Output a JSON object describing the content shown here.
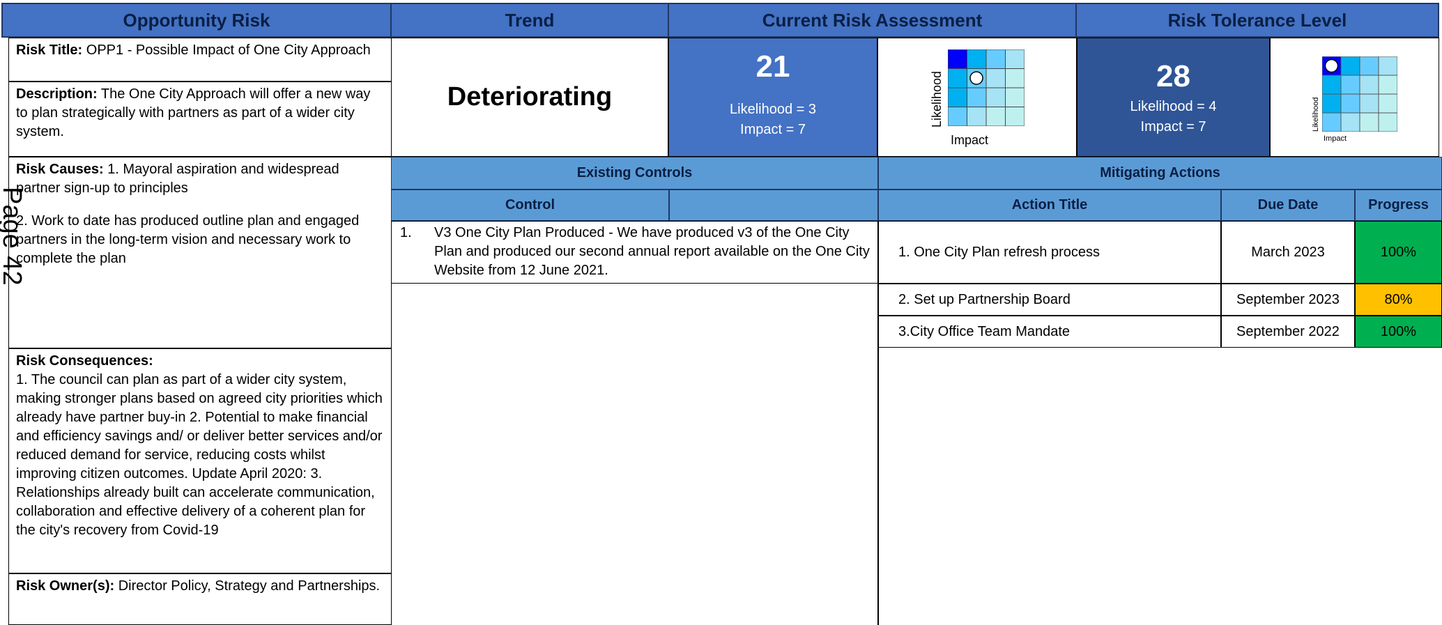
{
  "headers": {
    "opportunity_risk": "Opportunity Risk",
    "trend": "Trend",
    "current_risk": "Current Risk Assessment",
    "tolerance": "Risk Tolerance Level"
  },
  "risk": {
    "title_label": "Risk Title:",
    "title": "OPP1 - Possible Impact of One City Approach",
    "description_label": "Description:",
    "description": "The One City Approach will offer a new way to plan strategically with partners as part of a wider city system.",
    "causes_label": "Risk Causes:",
    "causes_1": "1. Mayoral aspiration and widespread partner sign-up to principles",
    "causes_2": "2. Work to date has produced outline plan and engaged partners in the long-term vision and necessary work to complete the plan",
    "consequences_label": "Risk Consequences:",
    "consequences": "1. The council can plan as part of a wider city system, making stronger plans based on agreed city priorities which already have partner buy-in 2. Potential to make financial and efficiency savings and/ or deliver better services and/or reduced demand for service, reducing costs whilst improving citizen outcomes. Update April 2020: 3. Relationships already built can accelerate communication, collaboration and effective delivery of a coherent plan for the city's recovery from Covid-19",
    "owner_label": "Risk Owner(s):",
    "owner": "Director Policy, Strategy and Partnerships."
  },
  "trend_value": "Deteriorating",
  "current": {
    "score": "21",
    "likelihood": "Likelihood = 3",
    "impact": "Impact = 7",
    "axis_y": "Likelihood",
    "axis_x": "Impact",
    "likelihood_value": 3,
    "impact_value": 7
  },
  "tolerance": {
    "score": "28",
    "likelihood": "Likelihood = 4",
    "impact": "Impact = 7",
    "axis_y": "Likelihood",
    "axis_x": "Impact",
    "likelihood_value": 4,
    "impact_value": 7
  },
  "controls": {
    "section_title": "Existing Controls",
    "col_control": "Control",
    "items": [
      {
        "num": "1.",
        "text": "V3 One City Plan Produced - We have produced v3 of the One City Plan and produced our second annual report available on the One City Website from 12 June 2021."
      }
    ]
  },
  "actions": {
    "section_title": "Mitigating Actions",
    "col_title": "Action Title",
    "col_due": "Due Date",
    "col_progress": "Progress",
    "rows": [
      {
        "title": "1. One City Plan refresh process",
        "due": "March 2023",
        "progress": "100%",
        "color": "#00b050"
      },
      {
        "title": "2. Set up Partnership Board",
        "due": "September 2023",
        "progress": "80%",
        "color": "#ffc000"
      },
      {
        "title": "3.City Office Team Mandate",
        "due": "September 2022",
        "progress": "100%",
        "color": "#00b050"
      }
    ]
  },
  "watermark": "Page 42",
  "colors": {
    "header_blue": "#4472c4",
    "subheader_blue": "#5b9bd5",
    "score_blue": "#4472c4",
    "tolerance_blue": "#2f5597"
  }
}
